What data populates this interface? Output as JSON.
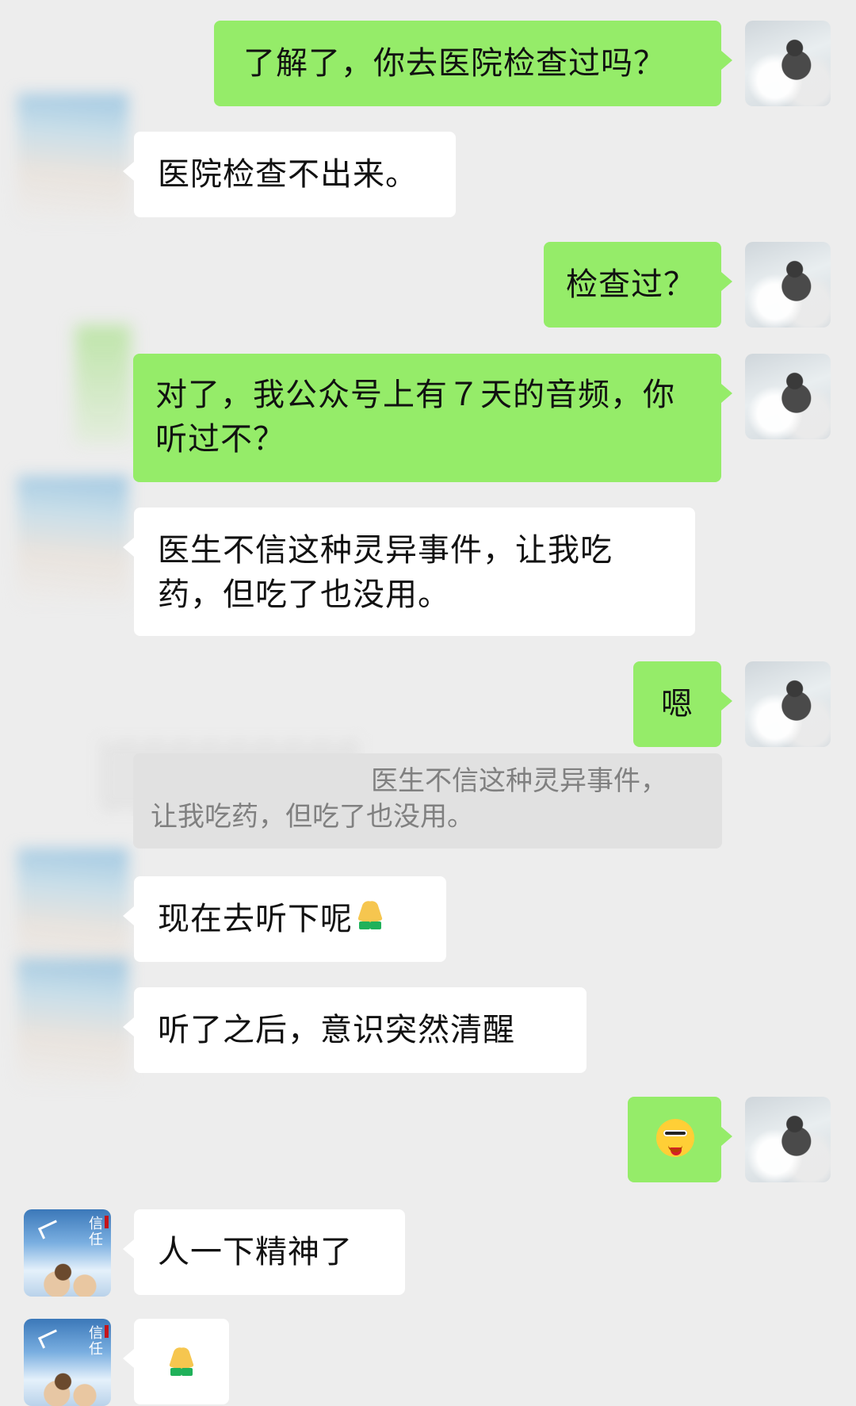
{
  "messages": [
    {
      "side": "right",
      "text": "了解了，你去医院检查过吗？"
    },
    {
      "side": "left",
      "text": "医院检查不出来。"
    },
    {
      "side": "right",
      "text": "检查过？"
    },
    {
      "side": "right",
      "text": "对了，我公众号上有７天的音频，你听过不？"
    },
    {
      "side": "left",
      "text": "医生不信这种灵异事件，让我吃药，但吃了也没用。"
    },
    {
      "side": "right",
      "text": "嗯"
    },
    {
      "side": "left",
      "text": "现在去听下呢"
    },
    {
      "side": "left",
      "text": "听了之后，意识突然清醒"
    },
    {
      "side": "right",
      "text": ""
    },
    {
      "side": "left",
      "text": "人一下精神了"
    },
    {
      "side": "left",
      "text": ""
    }
  ],
  "quote": {
    "line1": "医生不信这种灵异事件，",
    "line2": "让我吃药，但吃了也没用。"
  },
  "emoji": {
    "pray": "pray-emoji",
    "smirk": "smirk-emoji"
  },
  "avatar_badge": {
    "text": "信任"
  }
}
